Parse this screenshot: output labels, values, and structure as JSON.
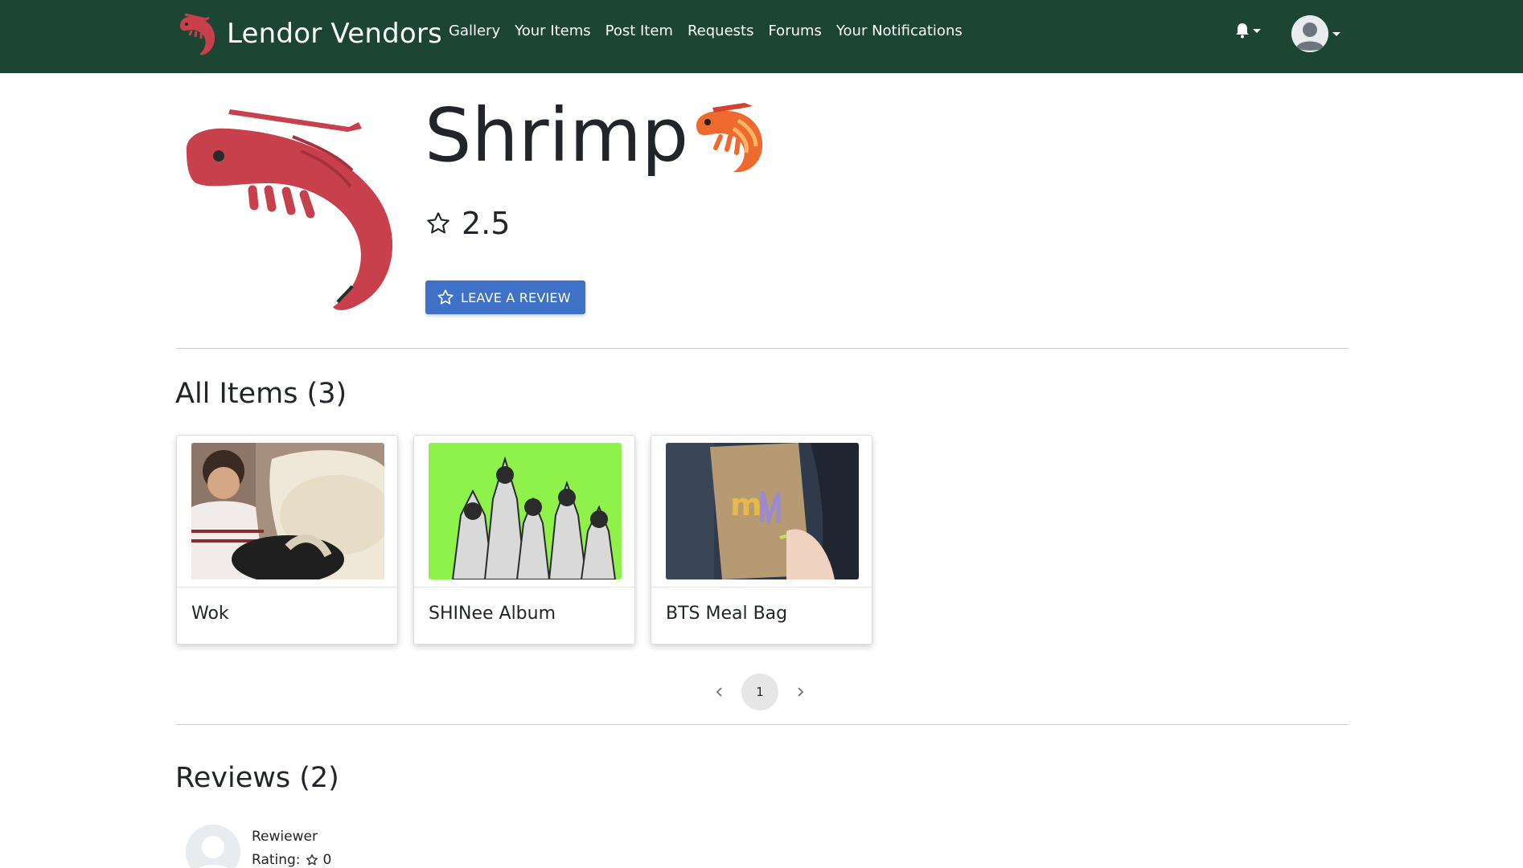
{
  "navbar": {
    "brand": "Lendor Vendors",
    "links": [
      "Gallery",
      "Your Items",
      "Post Item",
      "Requests",
      "Forums",
      "Your Notifications"
    ]
  },
  "profile": {
    "name": "Shrimp",
    "rating": "2.5",
    "review_button": "LEAVE A REVIEW"
  },
  "items": {
    "title": "All Items (3)",
    "cards": [
      {
        "title": "Wok"
      },
      {
        "title": "SHINee Album"
      },
      {
        "title": "BTS Meal Bag"
      }
    ],
    "current_page": "1"
  },
  "reviews": {
    "title": "Reviews (2)",
    "list": [
      {
        "name": "Rewiewer",
        "rating_label": "Rating:",
        "rating_value": "0"
      }
    ]
  },
  "colors": {
    "navbar": "#1d4533",
    "button": "#3f72c6",
    "shrimp": "#c9404d"
  }
}
